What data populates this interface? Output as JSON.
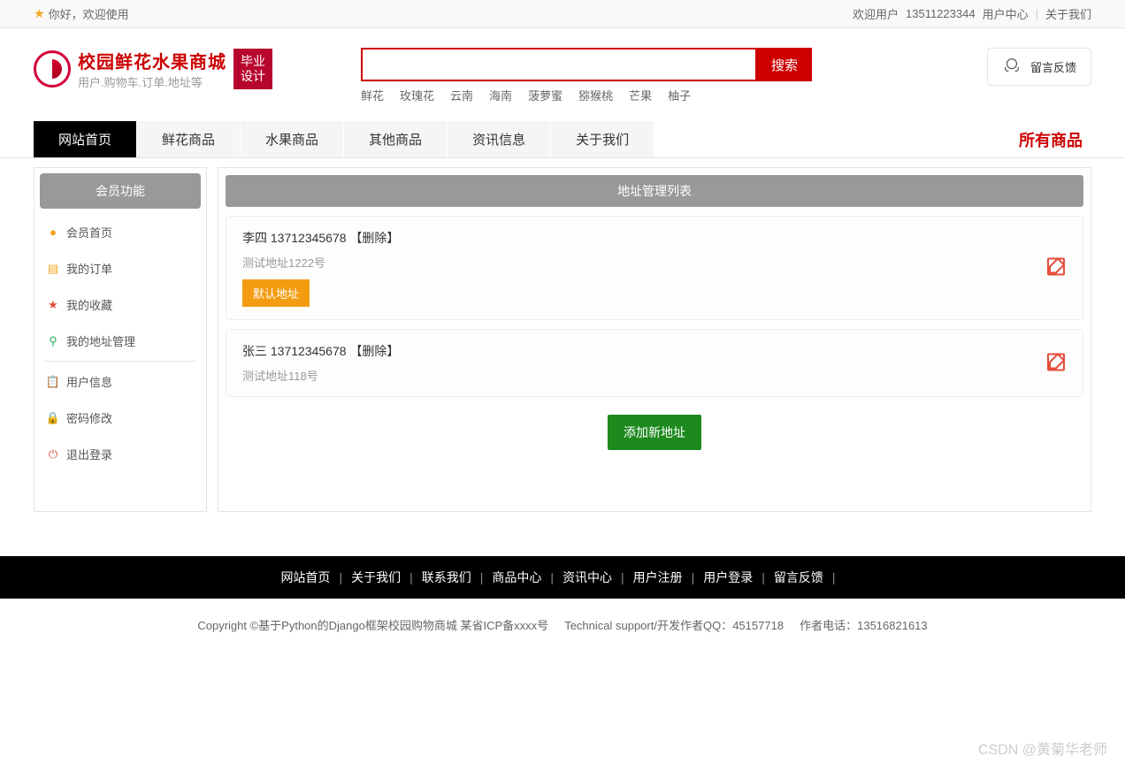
{
  "topbar": {
    "welcome": "你好，欢迎使用",
    "welcome_user": "欢迎用户",
    "phone": "13511223344",
    "user_center": "用户中心",
    "about": "关于我们"
  },
  "logo": {
    "title": "校园鲜花水果商城",
    "subtitle": "用户.购物车.订单.地址等",
    "badge_line1": "毕业",
    "badge_line2": "设计"
  },
  "search": {
    "button": "搜索",
    "placeholder": "",
    "hot": [
      "鲜花",
      "玫瑰花",
      "云南",
      "海南",
      "菠萝蜜",
      "猕猴桃",
      "芒果",
      "柚子"
    ]
  },
  "feedback": {
    "label": "留言反馈"
  },
  "nav": {
    "items": [
      "网站首页",
      "鲜花商品",
      "水果商品",
      "其他商品",
      "资讯信息",
      "关于我们"
    ],
    "right": "所有商品"
  },
  "sidebar": {
    "title": "会员功能",
    "items": [
      {
        "label": "会员首页",
        "icon": "●",
        "cls": "ic-orange"
      },
      {
        "label": "我的订单",
        "icon": "▤",
        "cls": "ic-doc"
      },
      {
        "label": "我的收藏",
        "icon": "★",
        "cls": "ic-star"
      },
      {
        "label": "我的地址管理",
        "icon": "⚲",
        "cls": "ic-loc"
      }
    ],
    "items2": [
      {
        "label": "用户信息",
        "icon": "📋",
        "cls": "ic-user"
      },
      {
        "label": "密码修改",
        "icon": "🔒",
        "cls": "ic-lock"
      },
      {
        "label": "退出登录",
        "icon": "⏻",
        "cls": "ic-power"
      }
    ]
  },
  "panel": {
    "title": "地址管理列表",
    "default_label": "默认地址",
    "delete_label": "【删除】",
    "add_label": "添加新地址",
    "addresses": [
      {
        "name": "李四",
        "phone": "13712345678",
        "detail": "测试地址1222号",
        "is_default": true
      },
      {
        "name": "张三",
        "phone": "13712345678",
        "detail": "测试地址118号",
        "is_default": false
      }
    ]
  },
  "footer": {
    "nav": [
      "网站首页",
      "关于我们",
      "联系我们",
      "商品中心",
      "资讯中心",
      "用户注册",
      "用户登录",
      "留言反馈"
    ],
    "copyright": "Copyright ©基于Python的Django框架校园购物商城 某省ICP备xxxx号",
    "support": "Technical support/开发作者QQ：45157718",
    "author_tel": "作者电话：13516821613"
  },
  "watermark": "CSDN @黄菊华老师"
}
